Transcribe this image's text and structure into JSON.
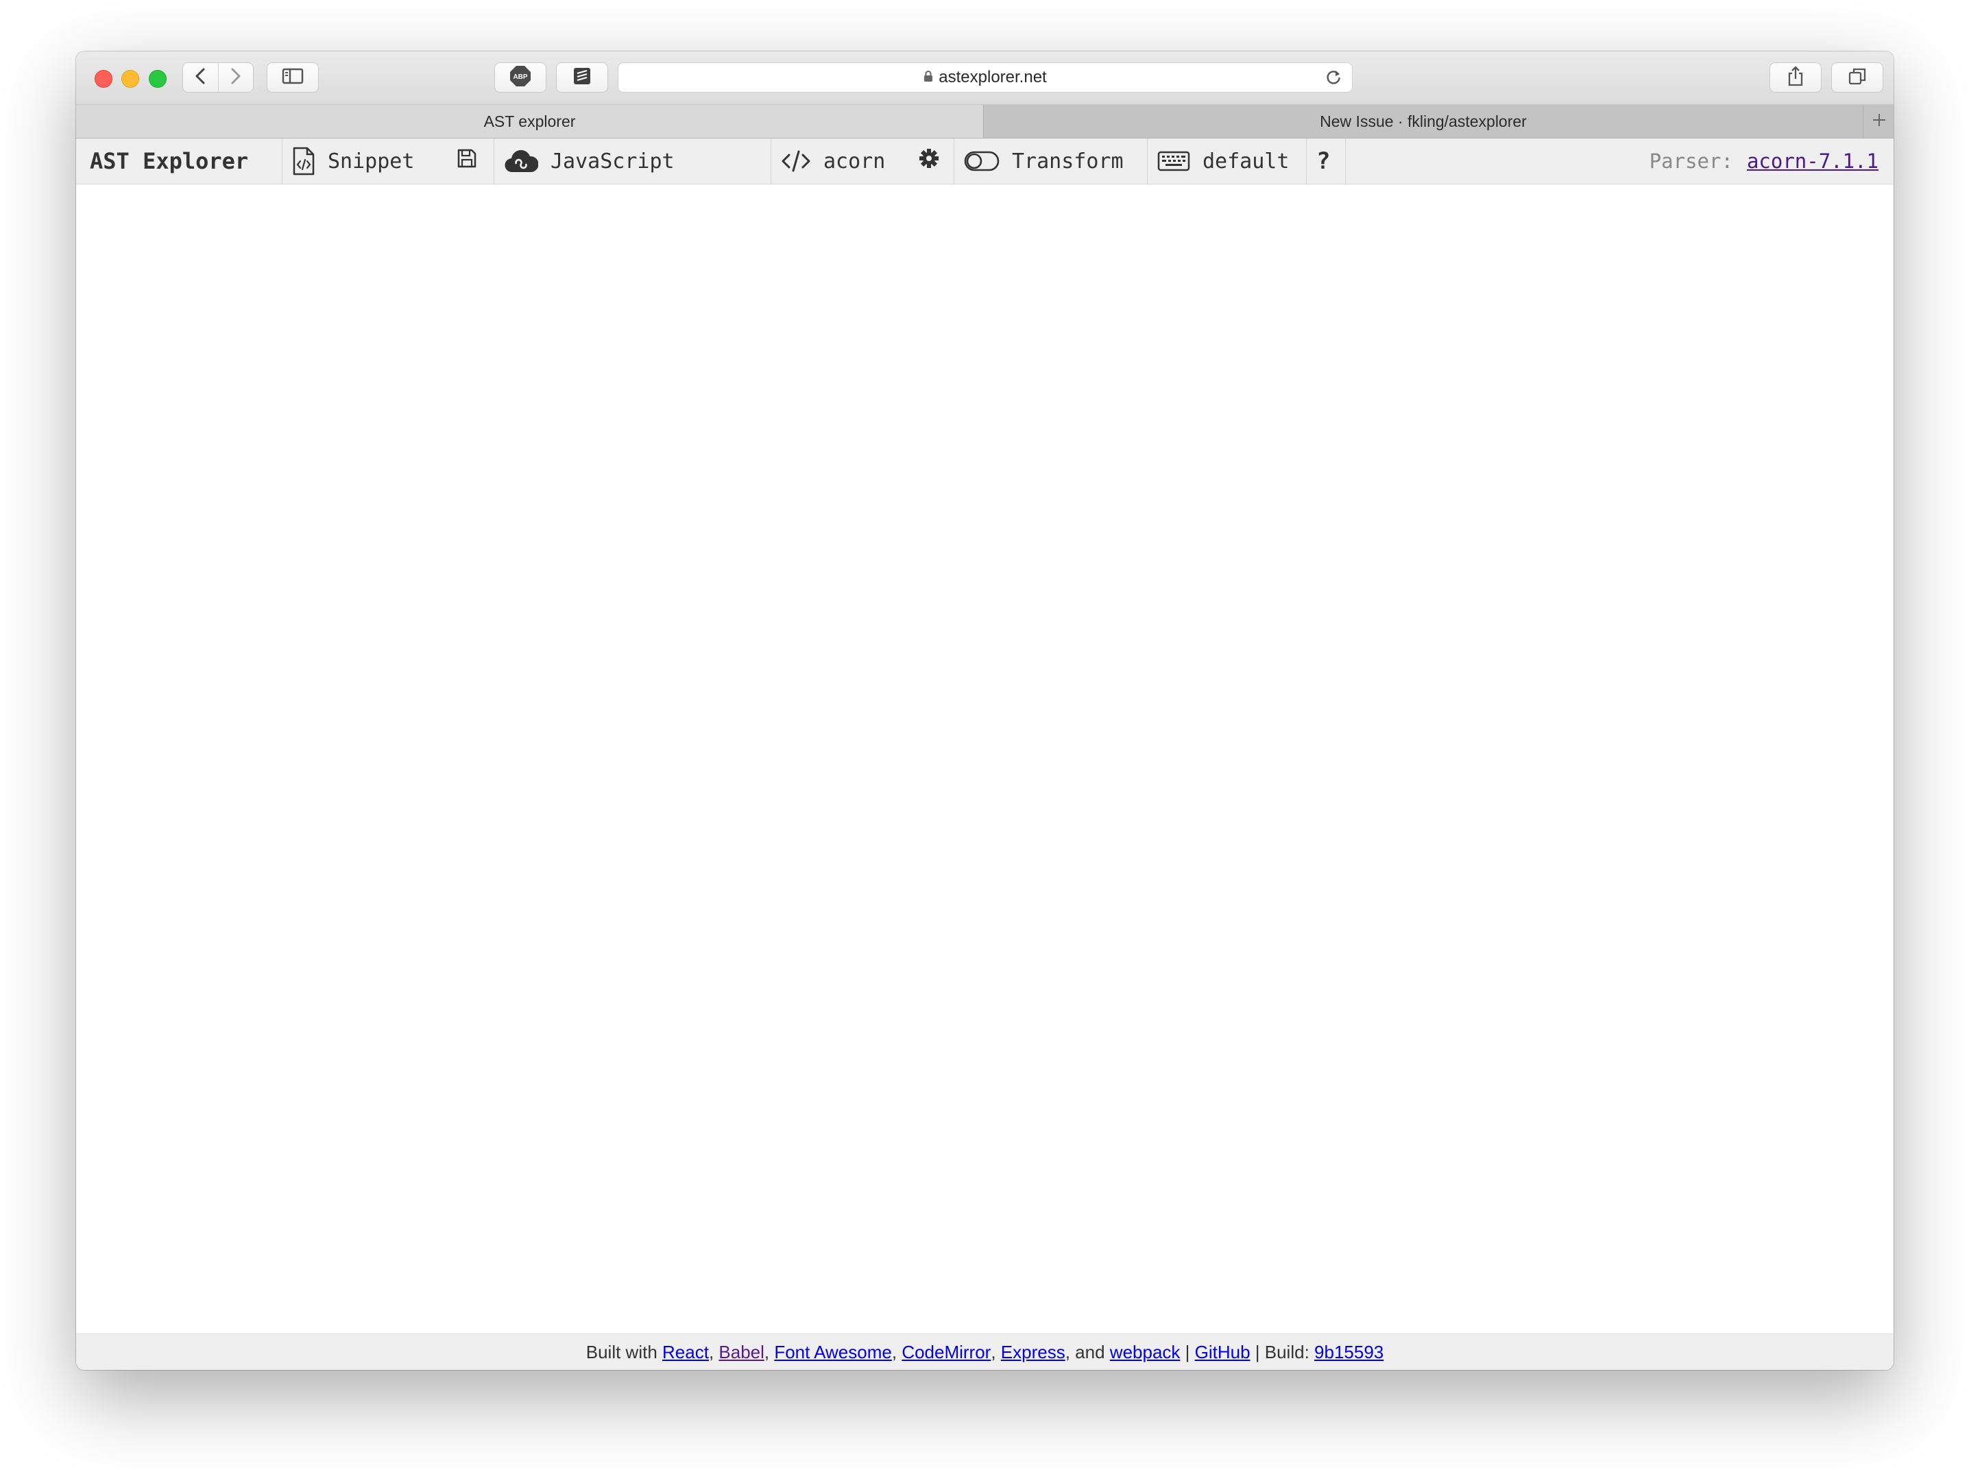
{
  "browser": {
    "address": "astexplorer.net",
    "tabs": [
      {
        "label": "AST explorer",
        "active": true
      },
      {
        "label": "New Issue · fkling/astexplorer",
        "active": false
      }
    ],
    "colors": {
      "close": "#fe5f57",
      "minimize": "#febc2e",
      "zoom": "#28c840"
    },
    "icons": [
      "back-icon",
      "forward-icon",
      "sidebar-icon",
      "adblock-icon",
      "extension-icon",
      "lock-icon",
      "reload-icon",
      "share-icon",
      "tabs-overview-icon",
      "new-tab-icon"
    ]
  },
  "toolbar": {
    "title": "AST Explorer",
    "snippet": "Snippet",
    "language": "JavaScript",
    "parser": "acorn",
    "transform": "Transform",
    "keymap": "default",
    "help": "?",
    "parser_label": "Parser:",
    "parser_version": "acorn-7.1.1"
  },
  "footer": {
    "built_with": "Built with",
    "links": [
      "React",
      "Babel",
      "Font Awesome",
      "CodeMirror",
      "Express",
      "webpack"
    ],
    "and": "and",
    "github": "GitHub",
    "build_label": "Build:",
    "build_hash": "9b15593"
  }
}
